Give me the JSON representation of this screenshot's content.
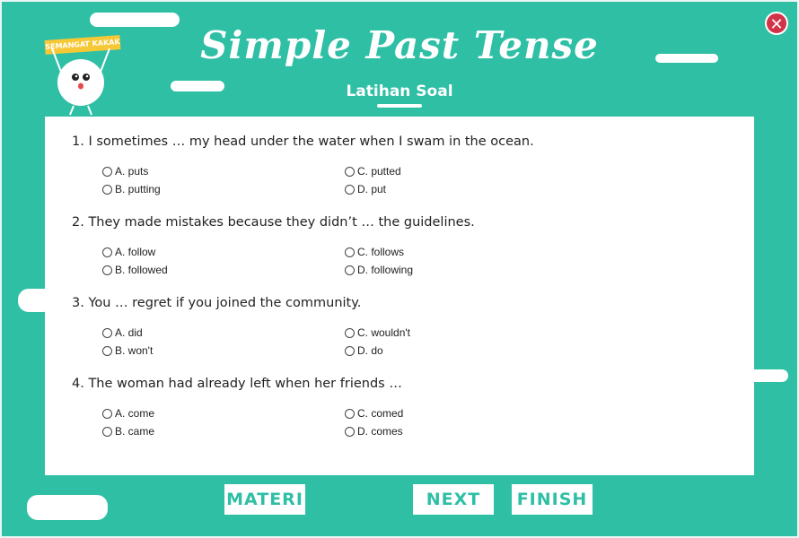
{
  "header": {
    "title": "Simple Past Tense",
    "subtitle": "Latihan Soal",
    "mascot_sign": "SEMANGAT KAKAK",
    "close_icon": "close-icon",
    "close_glyph": "✕"
  },
  "questions": [
    {
      "text": "1. I sometimes … my head under the water when I swam in the ocean.",
      "options": [
        "A. puts",
        "B. putting",
        "C. putted",
        "D. put"
      ]
    },
    {
      "text": "2. They made mistakes because they didn’t … the guidelines.",
      "options": [
        "A. follow",
        "B. followed",
        "C. follows",
        "D. following"
      ]
    },
    {
      "text": "3. You … regret if you joined the community.",
      "options": [
        "A. did",
        "B. won't",
        "C. wouldn't",
        "D. do"
      ]
    },
    {
      "text": "4. The woman had already left when her friends …",
      "options": [
        "A. come",
        "B. came",
        "C. comed",
        "D. comes"
      ]
    }
  ],
  "footer": {
    "materi_label": "MATERI",
    "next_label": "NEXT",
    "finish_label": "FINISH"
  },
  "colors": {
    "background": "#2ebfa5",
    "close": "#d23349",
    "sign": "#f7c835"
  }
}
